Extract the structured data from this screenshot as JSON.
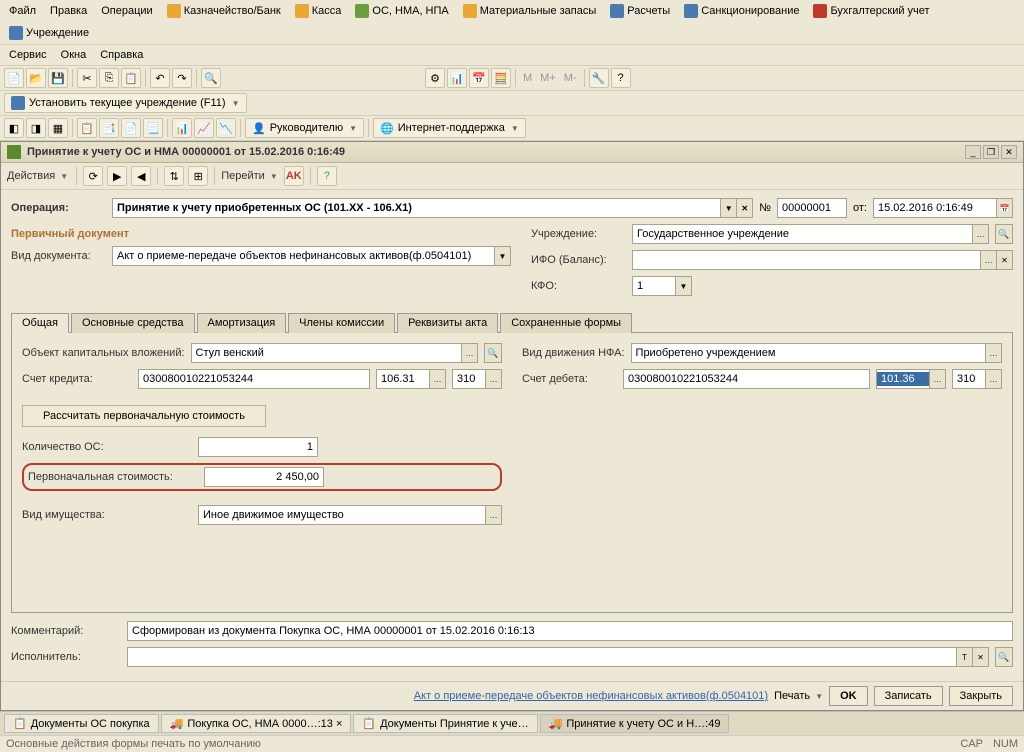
{
  "menu": {
    "file": "Файл",
    "edit": "Правка",
    "operations": "Операции",
    "treasury": "Казначейство/Банк",
    "cash": "Касса",
    "os": "ОС, НМА, НПА",
    "materials": "Материальные запасы",
    "calc": "Расчеты",
    "sanction": "Санкционирование",
    "accounting": "Бухгалтерский учет",
    "institution": "Учреждение",
    "service": "Сервис",
    "windows": "Окна",
    "help": "Справка"
  },
  "toolbar3": {
    "set_inst": "Установить текущее учреждение (F11)"
  },
  "toolbar4": {
    "manager": "Руководителю",
    "support": "Интернет-поддержка"
  },
  "doc": {
    "title": "Принятие к учету ОС и НМА 00000001 от 15.02.2016 0:16:49",
    "actions": "Действия",
    "goto": "Перейти",
    "op_label": "Операция:",
    "op_value": "Принятие к учету приобретенных ОС (101.XX - 106.X1)",
    "num_label": "№",
    "num_value": "00000001",
    "date_label": "от:",
    "date_value": "15.02.2016 0:16:49",
    "section_primary": "Первичный документ",
    "doctype_label": "Вид документа:",
    "doctype_value": "Акт о приеме-передаче объектов нефинансовых активов(ф.0504101)",
    "inst_label": "Учреждение:",
    "inst_value": "Государственное учреждение",
    "ifo_label": "ИФО (Баланс):",
    "ifo_value": "",
    "kfo_label": "КФО:",
    "kfo_value": "1",
    "tabs": {
      "general": "Общая",
      "os": "Основные средства",
      "amort": "Амортизация",
      "members": "Члены комиссии",
      "reqs": "Реквизиты акта",
      "saved": "Сохраненные формы"
    },
    "obj_label": "Объект капитальных вложений:",
    "obj_value": "Стул венский",
    "move_label": "Вид движения НФА:",
    "move_value": "Приобретено учреждением",
    "credit_label": "Счет кредита:",
    "credit_acc": "030080010221053244",
    "credit_sub1": "106.31",
    "credit_sub2": "310",
    "debit_label": "Счет дебета:",
    "debit_acc": "030080010221053244",
    "debit_sub1": "101.36",
    "debit_sub2": "310",
    "calc_btn": "Рассчитать первоначальную стоимость",
    "qty_label": "Количество ОС:",
    "qty_value": "1",
    "cost_label": "Первоначальная стоимость:",
    "cost_value": "2 450,00",
    "prop_label": "Вид имущества:",
    "prop_value": "Иное движимое имущество",
    "comment_label": "Комментарий:",
    "comment_value": "Сформирован из документа Покупка ОС, НМА 00000001 от 15.02.2016 0:16:13",
    "exec_label": "Исполнитель:",
    "bottom_link": "Акт о приеме-передаче объектов нефинансовых активов(ф.0504101)",
    "print": "Печать",
    "ok": "OK",
    "save": "Записать",
    "close": "Закрыть"
  },
  "taskbar": {
    "t1": "Документы ОС покупка",
    "t2": "Покупка ОС, НМА 0000…:13 ×",
    "t3": "Документы Принятие к уче…",
    "t4": "Принятие к учету ОС и Н…:49"
  },
  "status": {
    "left": "Основные действия формы печать по умолчанию",
    "cap": "CAP",
    "num": "NUM"
  }
}
